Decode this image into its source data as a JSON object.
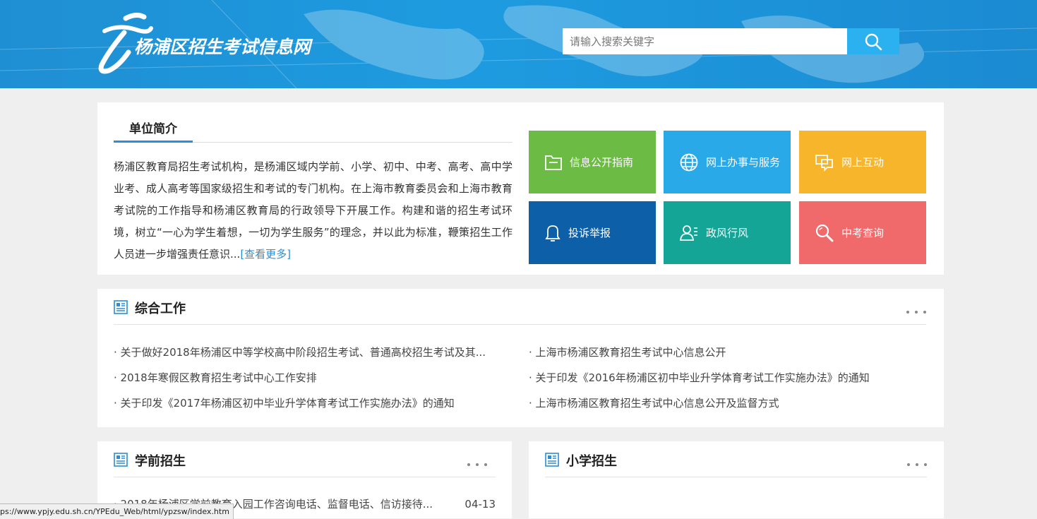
{
  "header": {
    "site_title": "杨浦区招生考试信息网",
    "search_placeholder": "请输入搜索关键字"
  },
  "intro": {
    "title": "单位简介",
    "text": "杨浦区教育局招生考试机构，是杨浦区域内学前、小学、初中、中考、高考、高中学业考、成人高考等国家级招生和考试的专门机构。在上海市教育委员会和上海市教育考试院的工作指导和杨浦区教育局的行政领导下开展工作。构建和谐的招生考试环境，树立“一心为学生着想，一切为学生服务”的理念，并以此为标准，鞭策招生工作人员进一步增强责任意识...",
    "more": "[查看更多]"
  },
  "tiles": [
    {
      "label": "信息公开指南",
      "color": "#6cbb45",
      "icon": "folder-icon"
    },
    {
      "label": "网上办事与服务",
      "color": "#29a9e8",
      "icon": "globe-icon"
    },
    {
      "label": "网上互动",
      "color": "#f7b52c",
      "icon": "chat-icon"
    },
    {
      "label": "投诉举报",
      "color": "#0d5fa8",
      "icon": "bell-icon"
    },
    {
      "label": "政风行风",
      "color": "#14a597",
      "icon": "user-list-icon"
    },
    {
      "label": "中考查询",
      "color": "#f06a6c",
      "icon": "search-icon"
    }
  ],
  "general": {
    "title": "综合工作",
    "left": [
      "· 关于做好2018年杨浦区中等学校高中阶段招生考试、普通高校招生考试及其...",
      "· 2018年寒假区教育招生考试中心工作安排",
      "· 关于印发《2017年杨浦区初中毕业升学体育考试工作实施办法》的通知"
    ],
    "right": [
      "· 上海市杨浦区教育招生考试中心信息公开",
      "· 关于印发《2016年杨浦区初中毕业升学体育考试工作实施办法》的通知",
      "· 上海市杨浦区教育招生考试中心信息公开及监督方式"
    ]
  },
  "preschool": {
    "title": "学前招生",
    "items": [
      {
        "text": "· 2018年杨浦区学前教育入园工作咨询电话、监督电话、信访接待...",
        "date": "04-13"
      }
    ]
  },
  "primary": {
    "title": "小学招生"
  },
  "status_url": "ps://www.ypjy.edu.sh.cn/YPEdu_Web/html/ypzsw/index.htm"
}
